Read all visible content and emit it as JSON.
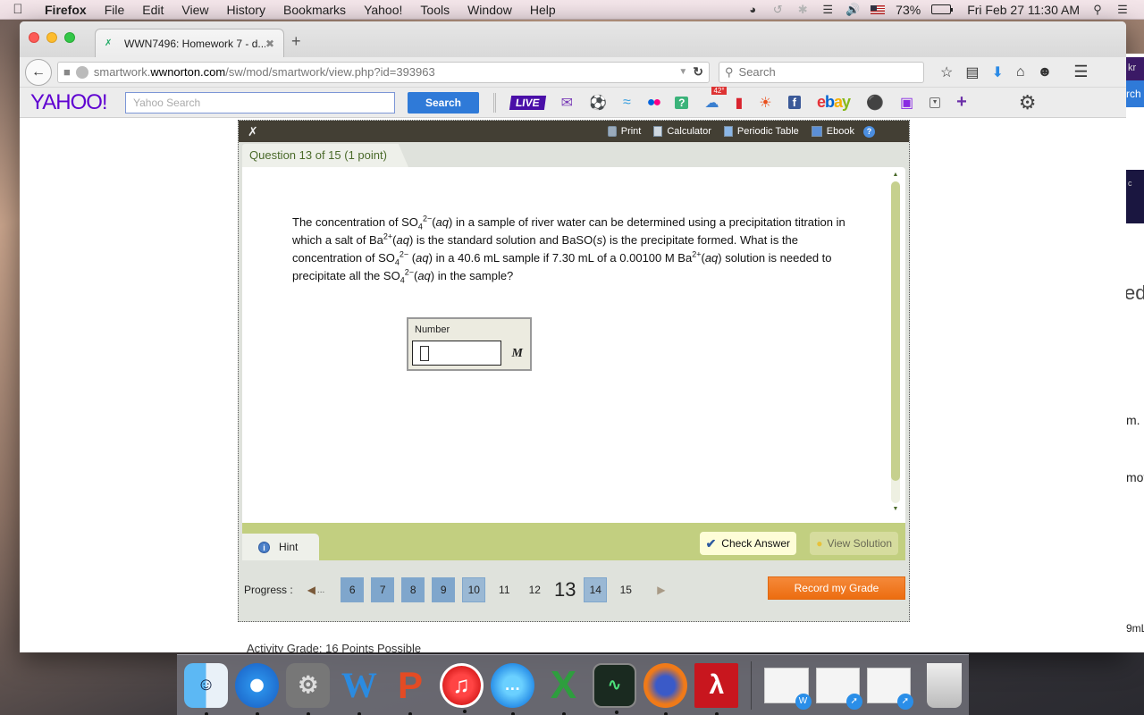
{
  "menubar": {
    "app_name": "Firefox",
    "items": [
      "File",
      "Edit",
      "View",
      "History",
      "Bookmarks",
      "Yahoo!",
      "Tools",
      "Window",
      "Help"
    ],
    "battery_percent": "73%",
    "battery_level": 0.73,
    "datetime": "Fri Feb 27  11:30 AM"
  },
  "browser": {
    "tab_title": "WWN7496: Homework 7 - d...",
    "url_prefix": "smartwork.",
    "url_host": "wwnorton.com",
    "url_path": "/sw/mod/smartwork/view.php?id=393963",
    "search_placeholder": "Search"
  },
  "yahoo_toolbar": {
    "logo": "YAHOO!",
    "search_placeholder": "Yahoo Search",
    "search_button": "Search",
    "live_label": "LIVE",
    "weather_temp": "42°",
    "ebay": [
      "e",
      "b",
      "a",
      "y"
    ]
  },
  "smartwork": {
    "tools": [
      "Print",
      "Calculator",
      "Periodic Table",
      "Ebook"
    ],
    "question_header": "Question 13 of 15 (1 point)",
    "question_parts": {
      "p1": "The concentration of SO",
      "sub4": "4",
      "sup2minus": "2−",
      "aq": "aq",
      "p2": " in a sample of river water can be determined using a precipitation titration in which a salt of Ba",
      "sup2plus": "2+",
      "p3": " is the standard solution and BaSO",
      "s": "s",
      "p4": " is the precipitate formed. What is the concentration of SO",
      "p5": " in a 40.6 mL sample if 7.30 mL of a 0.00100 M Ba",
      "p6": " solution is needed to precipitate all the SO",
      "p7": " in the sample?"
    },
    "answer": {
      "label": "Number",
      "value": "",
      "unit": "M"
    },
    "scroll_fraction": 0.93,
    "hint_label": "Hint",
    "check_answer_label": "Check Answer",
    "view_solution_label": "View Solution",
    "progress_label": "Progress :",
    "progress_ellipsis": "...",
    "progress": [
      {
        "n": "6",
        "state": "done"
      },
      {
        "n": "7",
        "state": "done"
      },
      {
        "n": "8",
        "state": "done"
      },
      {
        "n": "9",
        "state": "done"
      },
      {
        "n": "10",
        "state": "partial"
      },
      {
        "n": "11",
        "state": "none"
      },
      {
        "n": "12",
        "state": "none"
      },
      {
        "n": "13",
        "state": "current"
      },
      {
        "n": "14",
        "state": "partial"
      },
      {
        "n": "15",
        "state": "none"
      }
    ],
    "record_grade_label": "Record my Grade",
    "activity_grade": "Activity Grade: 16 Points Possible"
  },
  "peek_window": {
    "t1": "kr",
    "t2": "rch",
    "t3": "c",
    "t4": "ed",
    "t5": "m.",
    "t6": "mov",
    "t7": "9mL"
  },
  "dock": {
    "apps": [
      "Finder",
      "Safari",
      "System Preferences",
      "Word",
      "PowerPoint",
      "iTunes",
      "Messages",
      "Excel",
      "Activity Monitor",
      "Firefox",
      "Acrobat"
    ]
  }
}
